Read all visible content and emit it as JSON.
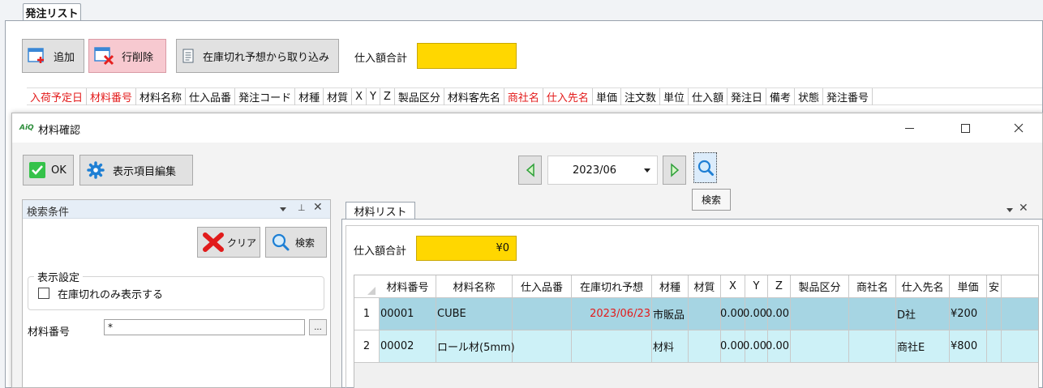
{
  "outer": {
    "tab_title": "発注リスト",
    "toolbar": {
      "add_label": "追加",
      "delete_row_label": "行削除",
      "import_label": "在庫切れ予想から取り込み",
      "total_label": "仕入額合計",
      "total_value": ""
    },
    "columns": [
      "入荷予定日",
      "材料番号",
      "材料名称",
      "仕入品番",
      "発注コード",
      "材種",
      "材質",
      "X",
      "Y",
      "Z",
      "製品区分",
      "材料客先名",
      "商社名",
      "仕入先名",
      "単価",
      "注文数",
      "単位",
      "仕入額",
      "発注日",
      "備考",
      "状態",
      "発注番号"
    ],
    "red_columns": [
      "入荷予定日",
      "材料番号",
      "商社名",
      "仕入先名"
    ]
  },
  "dialog": {
    "title": "材料確認",
    "app_icon_text": "AiQ",
    "ok_label": "OK",
    "edit_columns_label": "表示項目編集",
    "month": "2023/06",
    "search_tooltip": "検索",
    "search_panel": {
      "title": "検索条件",
      "clear_label": "クリア",
      "search_label": "検索",
      "display_group": "表示設定",
      "stock_out_only_label": "在庫切れのみ表示する",
      "stock_out_only_checked": false,
      "material_no_label": "材料番号",
      "material_no_value": "*",
      "browse_label": "..."
    },
    "list_panel": {
      "tab_title": "材料リスト",
      "total_label": "仕入額合計",
      "total_value": "¥0",
      "columns": [
        "材料番号",
        "材料名称",
        "仕入品番",
        "在庫切れ予想",
        "材種",
        "材質",
        "X",
        "Y",
        "Z",
        "製品区分",
        "商社名",
        "仕入先名",
        "単価",
        "安"
      ],
      "rows": [
        {
          "no": "1",
          "cells": [
            "00001",
            "CUBE",
            "",
            "2023/06/23",
            "市販品",
            "",
            "0.00",
            "0.00",
            "0.00",
            "",
            "",
            "D社",
            "¥200",
            ""
          ]
        },
        {
          "no": "2",
          "cells": [
            "00002",
            "ロール材(5mm)",
            "",
            "",
            "材料",
            "",
            "0.00",
            "0.00",
            "0.00",
            "",
            "",
            "商社E",
            "¥800",
            ""
          ]
        }
      ]
    }
  },
  "colors": {
    "accent_yellow": "#ffd700",
    "row1": "#a6d5e3",
    "row2": "#cdf1f7",
    "red": "#e31b1b",
    "ok_green": "#35c24a",
    "gear_blue": "#1e7fd4"
  }
}
